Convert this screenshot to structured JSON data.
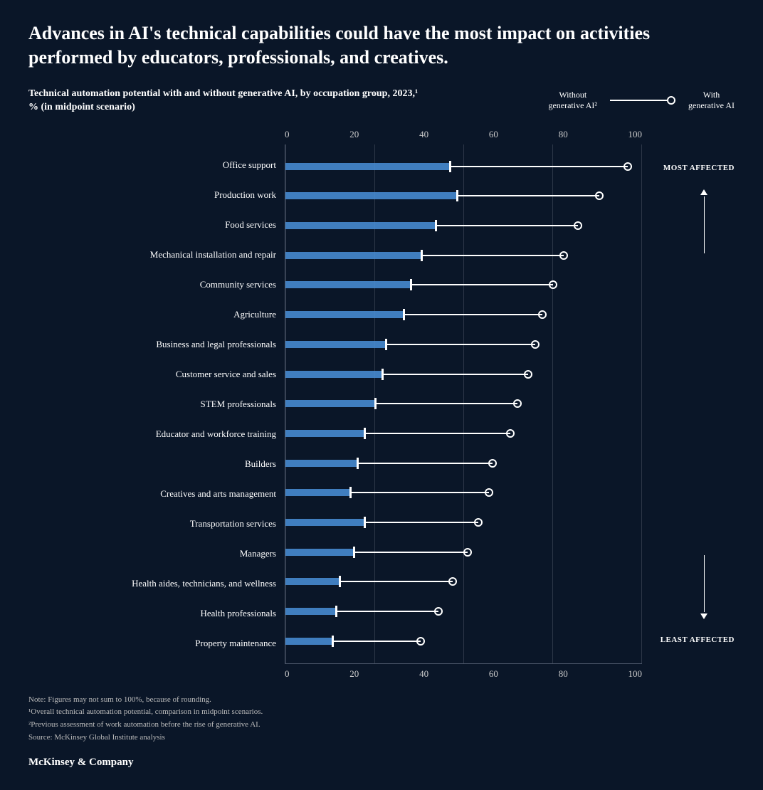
{
  "title": "Advances in AI's technical capabilities could have the most impact on activities performed by educators, professionals, and creatives.",
  "subtitle": "Technical automation potential with and without generative AI, by occupation group, 2023,¹ % (in midpoint scenario)",
  "legend": {
    "without_label": "Without\ngenerative AI²",
    "with_label": "With\ngenerative AI"
  },
  "x_axis_labels": [
    "0",
    "20",
    "40",
    "60",
    "80",
    "100"
  ],
  "categories": [
    {
      "label": "Office support",
      "without": 46,
      "with": 96
    },
    {
      "label": "Production work",
      "without": 48,
      "with": 88
    },
    {
      "label": "Food services",
      "without": 42,
      "with": 82
    },
    {
      "label": "Mechanical installation and repair",
      "without": 38,
      "with": 78
    },
    {
      "label": "Community services",
      "without": 35,
      "with": 75
    },
    {
      "label": "Agriculture",
      "without": 33,
      "with": 72
    },
    {
      "label": "Business and legal professionals",
      "without": 28,
      "with": 70
    },
    {
      "label": "Customer service and sales",
      "without": 27,
      "with": 68
    },
    {
      "label": "STEM professionals",
      "without": 25,
      "with": 65
    },
    {
      "label": "Educator and workforce training",
      "without": 22,
      "with": 63
    },
    {
      "label": "Builders",
      "without": 20,
      "with": 58
    },
    {
      "label": "Creatives and arts management",
      "without": 18,
      "with": 57
    },
    {
      "label": "Transportation services",
      "without": 22,
      "with": 54
    },
    {
      "label": "Managers",
      "without": 19,
      "with": 51
    },
    {
      "label": "Health aides, technicians, and wellness",
      "without": 15,
      "with": 47
    },
    {
      "label": "Health professionals",
      "without": 14,
      "with": 43
    },
    {
      "label": "Property maintenance",
      "without": 13,
      "with": 38
    }
  ],
  "most_affected_label": "MOST\nAFFECTED",
  "least_affected_label": "LEAST\nAFFECTED",
  "footnotes": [
    "Note: Figures may not sum to 100%, because of rounding.",
    "¹Overall technical automation potential, comparison in midpoint scenarios.",
    "²Previous assessment of work automation before the rise of generative AI.",
    "Source: McKinsey Global Institute analysis"
  ],
  "brand": "McKinsey & Company"
}
